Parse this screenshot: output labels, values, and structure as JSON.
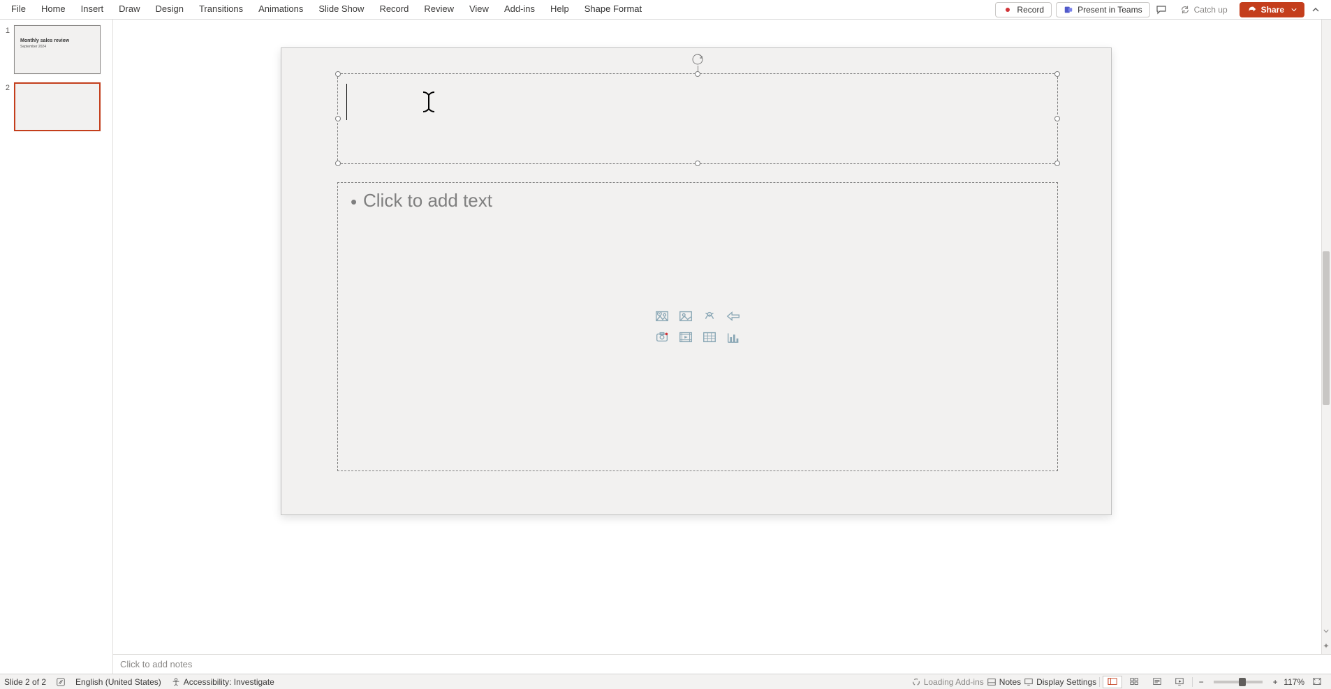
{
  "ribbon": {
    "tabs": [
      "File",
      "Home",
      "Insert",
      "Draw",
      "Design",
      "Transitions",
      "Animations",
      "Slide Show",
      "Record",
      "Review",
      "View",
      "Add-ins",
      "Help",
      "Shape Format"
    ],
    "record_btn_label": "Record",
    "present_label": "Present in Teams",
    "catch_up_label": "Catch up",
    "share_label": "Share"
  },
  "thumbnails": {
    "slides": [
      {
        "number": "1",
        "title": "Monthly sales review",
        "subtitle": "September 2024",
        "selected": false
      },
      {
        "number": "2",
        "title": "",
        "subtitle": "",
        "selected": true
      }
    ]
  },
  "slide": {
    "content_bullet": "•",
    "content_placeholder": "Click to add text"
  },
  "notes": {
    "placeholder": "Click to add notes"
  },
  "status": {
    "slide_counter": "Slide 2 of 2",
    "language": "English (United States)",
    "accessibility": "Accessibility: Investigate",
    "loading": "Loading Add-ins",
    "notes_label": "Notes",
    "display_settings": "Display Settings",
    "zoom_value": "117%"
  },
  "icons": {
    "content_grid": [
      "stock-image-icon",
      "picture-icon",
      "icons-icon",
      "smartart-icon",
      "cameo-icon",
      "video-icon",
      "table-icon",
      "chart-icon"
    ]
  }
}
